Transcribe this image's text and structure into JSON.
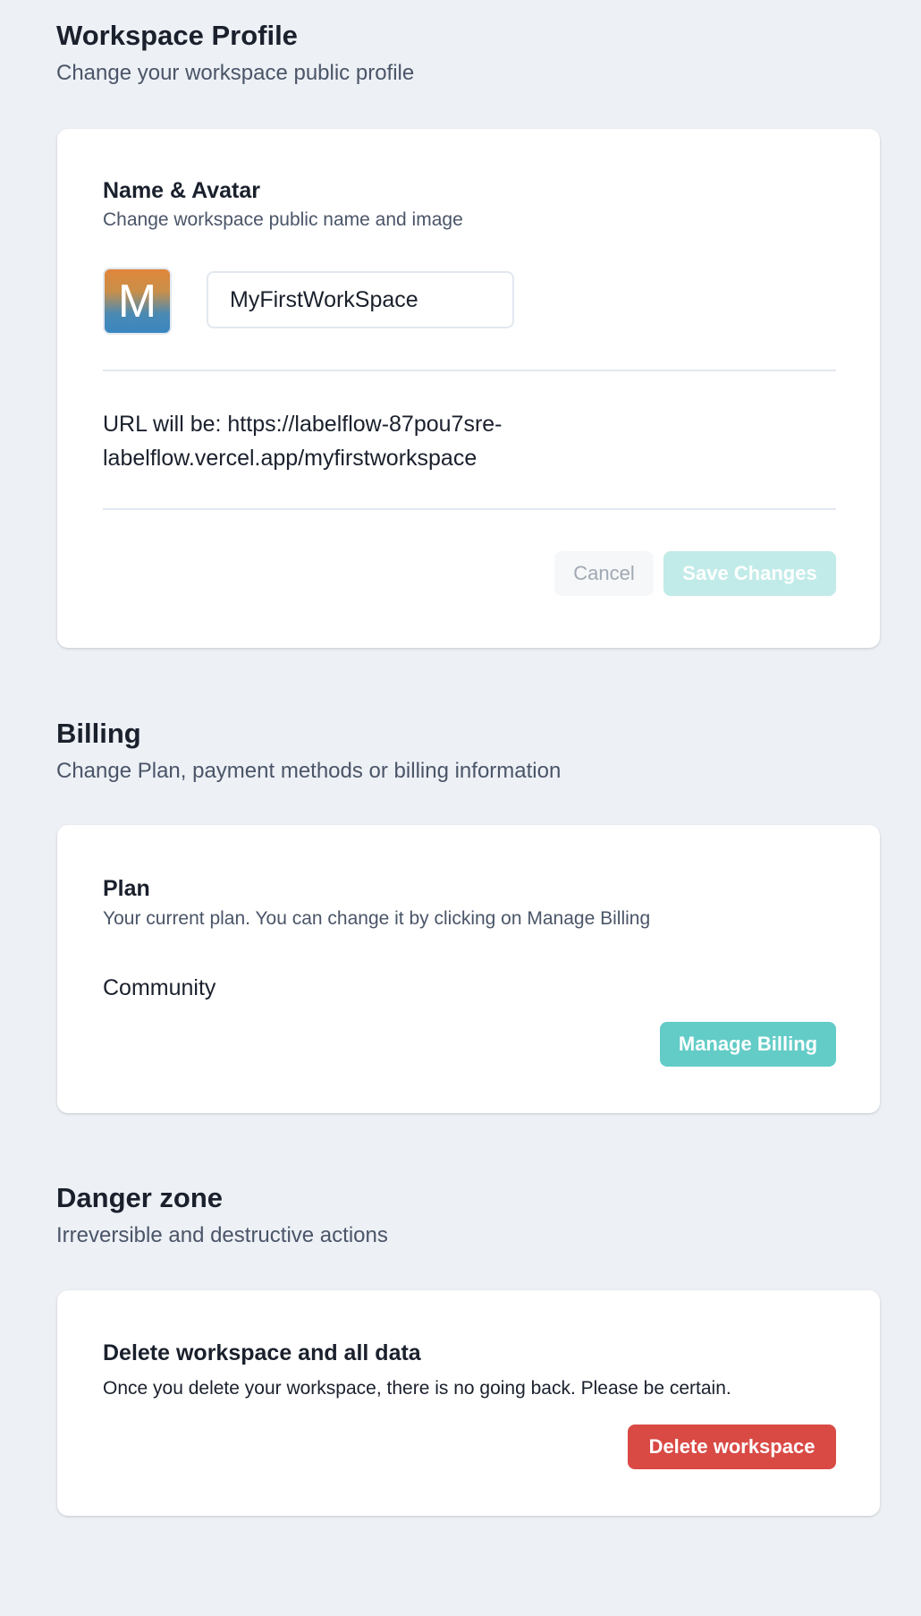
{
  "profile": {
    "title": "Workspace Profile",
    "subtitle": "Change your workspace public profile",
    "card": {
      "title": "Name & Avatar",
      "subtitle": "Change workspace public name and image",
      "avatar_letter": "M",
      "name_value": "MyFirstWorkSpace",
      "url_text": "URL will be: https://labelflow-87pou7sre-labelflow.vercel.app/myfirstworkspace",
      "cancel_label": "Cancel",
      "save_label": "Save Changes"
    }
  },
  "billing": {
    "title": "Billing",
    "subtitle": "Change Plan, payment methods or billing information",
    "card": {
      "title": "Plan",
      "subtitle": "Your current plan. You can change it by clicking on Manage Billing",
      "plan_value": "Community",
      "manage_label": "Manage Billing"
    }
  },
  "danger": {
    "title": "Danger zone",
    "subtitle": "Irreversible and destructive actions",
    "card": {
      "title": "Delete workspace and all data",
      "subtitle": "Once you delete your workspace, there is no going back. Please be certain.",
      "delete_label": "Delete workspace"
    }
  },
  "colors": {
    "background": "#edf0f5",
    "accent": "#63ccc7",
    "accent_disabled": "#c1ebe8",
    "danger": "#d94a45"
  }
}
